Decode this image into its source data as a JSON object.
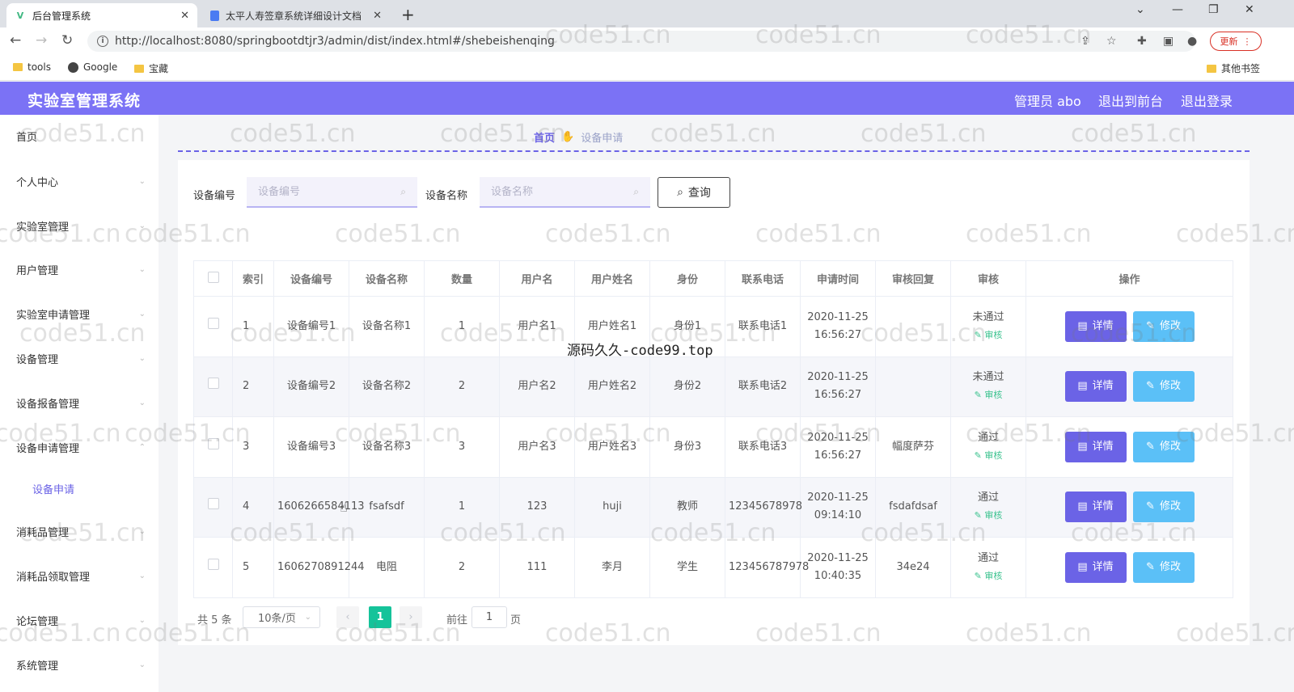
{
  "browser": {
    "tabs": [
      {
        "title": "后台管理系统",
        "favicon": "V",
        "active": true
      },
      {
        "title": "太平人寿签章系统详细设计文档",
        "favicon": "doc",
        "active": false
      }
    ],
    "new_tab_symbol": "+",
    "url": "http://localhost:8080/springbootdtjr3/admin/dist/index.html#/shebeishenqing",
    "update_label": "更新",
    "bookmarks": [
      {
        "label": "tools",
        "icon": "folder-icon"
      },
      {
        "label": "Google",
        "icon": "globe-icon"
      },
      {
        "label": "宝藏",
        "icon": "folder-icon"
      }
    ],
    "other_bookmarks": "其他书签"
  },
  "header": {
    "title": "实验室管理系统",
    "user": "管理员 abo",
    "front_link": "退出到前台",
    "logout_link": "退出登录",
    "color": "#7b72f5"
  },
  "sidebar": {
    "items": [
      {
        "label": "首页"
      },
      {
        "label": "个人中心"
      },
      {
        "label": "实验室管理"
      },
      {
        "label": "用户管理"
      },
      {
        "label": "实验室申请管理"
      },
      {
        "label": "设备管理"
      },
      {
        "label": "设备报备管理"
      },
      {
        "label": "设备申请管理"
      },
      {
        "label": "消耗品管理"
      },
      {
        "label": "消耗品领取管理"
      },
      {
        "label": "论坛管理"
      },
      {
        "label": "系统管理"
      }
    ],
    "active_sub": "设备申请"
  },
  "breadcrumb": {
    "home": "首页",
    "current": "设备申请"
  },
  "search": {
    "code_label": "设备编号",
    "code_placeholder": "设备编号",
    "name_label": "设备名称",
    "name_placeholder": "设备名称",
    "query_label": "查询"
  },
  "table": {
    "columns": [
      "索引",
      "设备编号",
      "设备名称",
      "数量",
      "用户名",
      "用户姓名",
      "身份",
      "联系电话",
      "申请时间",
      "审核回复",
      "审核",
      "操作"
    ],
    "rows": [
      {
        "index": "1",
        "code": "设备编号1",
        "name": "设备名称1",
        "qty": "1",
        "username": "用户名1",
        "realname": "用户姓名1",
        "role": "身份1",
        "phone": "联系电话1",
        "time": "2020-11-25 16:56:27",
        "reply": "",
        "status": "未通过"
      },
      {
        "index": "2",
        "code": "设备编号2",
        "name": "设备名称2",
        "qty": "2",
        "username": "用户名2",
        "realname": "用户姓名2",
        "role": "身份2",
        "phone": "联系电话2",
        "time": "2020-11-25 16:56:27",
        "reply": "",
        "status": "未通过"
      },
      {
        "index": "3",
        "code": "设备编号3",
        "name": "设备名称3",
        "qty": "3",
        "username": "用户名3",
        "realname": "用户姓名3",
        "role": "身份3",
        "phone": "联系电话3",
        "time": "2020-11-25 16:56:27",
        "reply": "幅度萨芬",
        "status": "通过"
      },
      {
        "index": "4",
        "code": "1606266584113",
        "name": "fsafsdf",
        "qty": "1",
        "username": "123",
        "realname": "huji",
        "role": "教师",
        "phone": "12345678978",
        "time": "2020-11-25 09:14:10",
        "reply": "fsdafdsaf",
        "status": "通过"
      },
      {
        "index": "5",
        "code": "1606270891244",
        "name": "电阻",
        "qty": "2",
        "username": "111",
        "realname": "李月",
        "role": "学生",
        "phone": "123456787978",
        "time": "2020-11-25 10:40:35",
        "reply": "34e24",
        "status": "通过"
      }
    ],
    "audit_link": "审核",
    "detail_label": "详情",
    "edit_label": "修改"
  },
  "pagination": {
    "total": "共 5 条",
    "page_size": "10条/页",
    "current_page": "1",
    "goto_label": "前往",
    "goto_value": "1",
    "page_suffix": "页"
  },
  "overlay_text": "源码久久-code99.top",
  "watermark": "code51.cn",
  "colors": {
    "accent": "#6b63e6",
    "edit": "#5bc0f7",
    "pager_active": "#15c39a",
    "audit_link": "#3ac28e"
  }
}
